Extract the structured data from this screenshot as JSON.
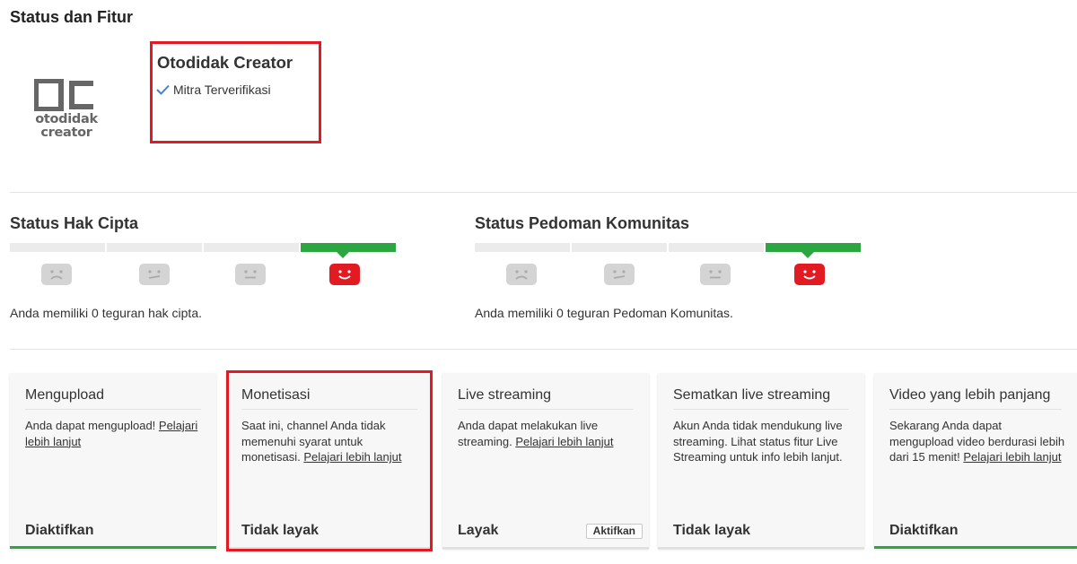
{
  "page": {
    "title": "Status dan Fitur"
  },
  "logo": {
    "mark": "OC",
    "word1": "otodidak",
    "word2": "creator"
  },
  "channel": {
    "name": "Otodidak Creator",
    "verified_label": "Mitra Terverifikasi"
  },
  "copyright": {
    "heading": "Status Hak Cipta",
    "strikes": 0,
    "summary": "Anda memiliki 0 teguran hak cipta."
  },
  "community": {
    "heading": "Status Pedoman Komunitas",
    "strikes": 0,
    "summary": "Anda memiliki 0 teguran Pedoman Komunitas."
  },
  "colors": {
    "accent_green": "#2ba640",
    "alert_red": "#e21b23",
    "inactive_gray": "#d4d4d4"
  },
  "cards": [
    {
      "title": "Mengupload",
      "body": "Anda dapat mengupload! ",
      "link": "Pelajari lebih lanjut",
      "body_after": "",
      "status": "Diaktifkan",
      "enabled": true
    },
    {
      "title": "Monetisasi",
      "body": "Saat ini, channel Anda tidak memenuhi syarat untuk monetisasi. ",
      "link": "Pelajari lebih lanjut",
      "body_after": "",
      "status": "Tidak layak",
      "enabled": false
    },
    {
      "title": "Live streaming",
      "body": "Anda dapat melakukan live streaming. ",
      "link": "Pelajari lebih lanjut",
      "body_after": "",
      "status": "Layak",
      "enabled": false,
      "button": "Aktifkan"
    },
    {
      "title": "Sematkan live streaming",
      "body": "Akun Anda tidak mendukung live streaming. Lihat status fitur Live Streaming untuk info lebih lanjut.",
      "link": "",
      "body_after": "",
      "status": "Tidak layak",
      "enabled": false
    },
    {
      "title": "Video yang lebih panjang",
      "body": "Sekarang Anda dapat mengupload video berdurasi lebih dari 15 menit! ",
      "link": "Pelajari lebih lanjut",
      "body_after": "",
      "status": "Diaktifkan",
      "enabled": true
    }
  ]
}
